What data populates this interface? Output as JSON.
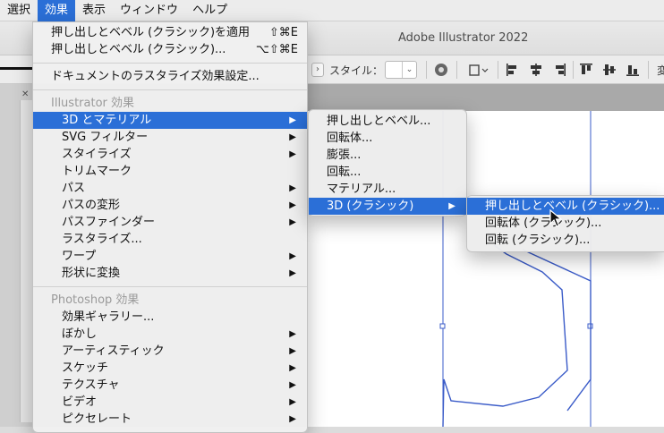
{
  "menubar": {
    "items": [
      "選択",
      "効果",
      "表示",
      "ウィンドウ",
      "ヘルプ"
    ]
  },
  "app": {
    "title": "Adobe Illustrator 2022"
  },
  "control_bar": {
    "style_label": "スタイル：",
    "cut_label": "変"
  },
  "effect_menu": {
    "apply_last": {
      "label": "押し出しとベベル (クラシック)を適用",
      "shortcut": "⇧⌘E"
    },
    "last_effect": {
      "label": "押し出しとベベル (クラシック)...",
      "shortcut": "⌥⇧⌘E"
    },
    "raster_settings": "ドキュメントのラスタライズ効果設定...",
    "illustrator_header": "Illustrator 効果",
    "illustrator_items": [
      {
        "label": "3D とマテリアル",
        "has_sub": true
      },
      {
        "label": "SVG フィルター",
        "has_sub": true
      },
      {
        "label": "スタイライズ",
        "has_sub": true
      },
      {
        "label": "トリムマーク",
        "has_sub": false
      },
      {
        "label": "パス",
        "has_sub": true
      },
      {
        "label": "パスの変形",
        "has_sub": true
      },
      {
        "label": "パスファインダー",
        "has_sub": true
      },
      {
        "label": "ラスタライズ...",
        "has_sub": false
      },
      {
        "label": "ワープ",
        "has_sub": true
      },
      {
        "label": "形状に変換",
        "has_sub": true
      }
    ],
    "photoshop_header": "Photoshop 効果",
    "photoshop_items": [
      {
        "label": "効果ギャラリー...",
        "has_sub": false
      },
      {
        "label": "ぼかし",
        "has_sub": true
      },
      {
        "label": "アーティスティック",
        "has_sub": true
      },
      {
        "label": "スケッチ",
        "has_sub": true
      },
      {
        "label": "テクスチャ",
        "has_sub": true
      },
      {
        "label": "ビデオ",
        "has_sub": true
      },
      {
        "label": "ピクセレート",
        "has_sub": true
      }
    ]
  },
  "submenu_3d": {
    "items": [
      "押し出しとベベル...",
      "回転体...",
      "膨張...",
      "回転...",
      "マテリアル...",
      "3D (クラシック)"
    ]
  },
  "submenu_classic": {
    "items": [
      "押し出しとベベル (クラシック)...",
      "回転体 (クラシック)...",
      "回転 (クラシック)..."
    ]
  },
  "colors": {
    "highlight": "#2b6fd7",
    "path_stroke": "#3a5bc8"
  }
}
